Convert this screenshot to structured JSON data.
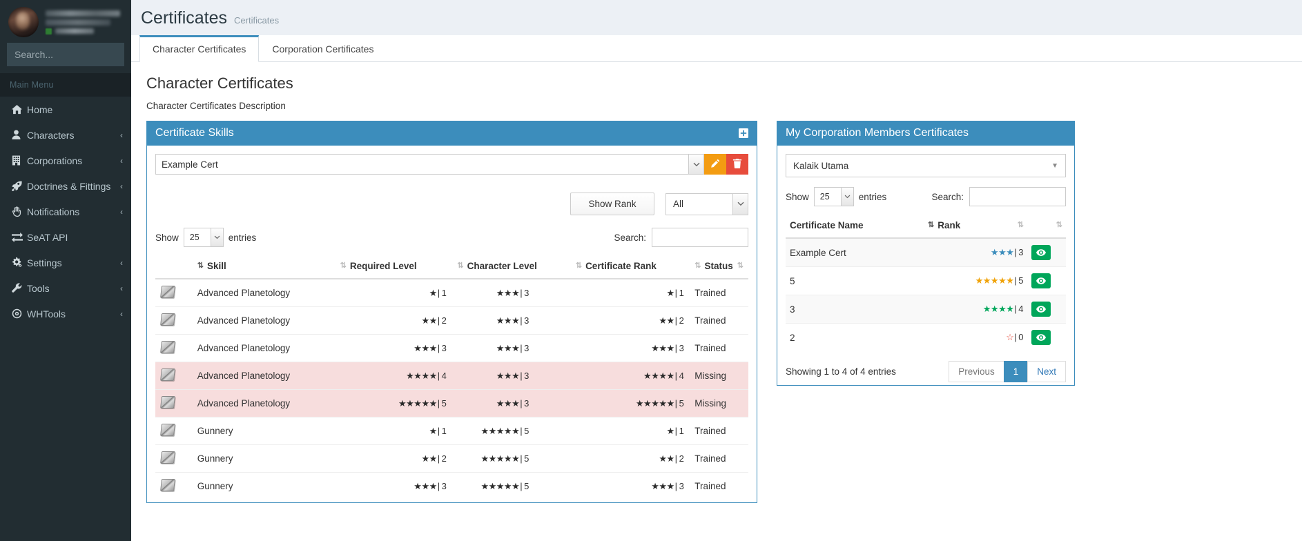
{
  "sidebar": {
    "user": {
      "name_redacted": true,
      "status_redacted": true
    },
    "search": {
      "placeholder": "Search...",
      "value": "",
      "icon": "search-icon"
    },
    "menu_header": "Main Menu",
    "items": [
      {
        "label": "Home",
        "icon": "home-icon",
        "arrow": ""
      },
      {
        "label": "Characters",
        "icon": "user-icon",
        "arrow": "‹"
      },
      {
        "label": "Corporations",
        "icon": "building-icon",
        "arrow": "‹"
      },
      {
        "label": "Doctrines & Fittings",
        "icon": "rocket-icon",
        "arrow": "‹"
      },
      {
        "label": "Notifications",
        "icon": "hand-icon",
        "arrow": "‹"
      },
      {
        "label": "SeAT API",
        "icon": "exchange-icon",
        "arrow": ""
      },
      {
        "label": "Settings",
        "icon": "gears-icon",
        "arrow": "‹"
      },
      {
        "label": "Tools",
        "icon": "wrench-icon",
        "arrow": "‹"
      },
      {
        "label": "WHTools",
        "icon": "circle-icon",
        "arrow": "‹"
      }
    ]
  },
  "header": {
    "title": "Certificates",
    "breadcrumb": "Certificates"
  },
  "tabs": [
    {
      "label": "Character Certificates",
      "active": true
    },
    {
      "label": "Corporation Certificates",
      "active": false
    }
  ],
  "main": {
    "section_title": "Character Certificates",
    "section_desc": "Character Certificates Description"
  },
  "cert_panel": {
    "title": "Certificate Skills",
    "expand_icon": "plus-square-icon",
    "selected_cert": "Example Cert",
    "edit_icon": "pencil-icon",
    "delete_icon": "trash-icon",
    "show_rank_label": "Show Rank",
    "rank_filter_value": "All",
    "show_label": "Show",
    "entries_label": "entries",
    "page_length": "25",
    "search_label": "Search:",
    "search_value": "",
    "columns": [
      "",
      "Skill",
      "Required Level",
      "Character Level",
      "Certificate Rank",
      "Status"
    ],
    "rows": [
      {
        "icon": "skillbook-icon",
        "skill": "Advanced Planetology",
        "required_level": 1,
        "character_level": 3,
        "certificate_rank": 1,
        "status": "Trained",
        "missing": false
      },
      {
        "icon": "skillbook-icon",
        "skill": "Advanced Planetology",
        "required_level": 2,
        "character_level": 3,
        "certificate_rank": 2,
        "status": "Trained",
        "missing": false
      },
      {
        "icon": "skillbook-icon",
        "skill": "Advanced Planetology",
        "required_level": 3,
        "character_level": 3,
        "certificate_rank": 3,
        "status": "Trained",
        "missing": false
      },
      {
        "icon": "skillbook-icon",
        "skill": "Advanced Planetology",
        "required_level": 4,
        "character_level": 3,
        "certificate_rank": 4,
        "status": "Missing",
        "missing": true
      },
      {
        "icon": "skillbook-icon",
        "skill": "Advanced Planetology",
        "required_level": 5,
        "character_level": 3,
        "certificate_rank": 5,
        "status": "Missing",
        "missing": true
      },
      {
        "icon": "skillbook-icon",
        "skill": "Gunnery",
        "required_level": 1,
        "character_level": 5,
        "certificate_rank": 1,
        "status": "Trained",
        "missing": false
      },
      {
        "icon": "skillbook-icon",
        "skill": "Gunnery",
        "required_level": 2,
        "character_level": 5,
        "certificate_rank": 2,
        "status": "Trained",
        "missing": false
      },
      {
        "icon": "skillbook-icon",
        "skill": "Gunnery",
        "required_level": 3,
        "character_level": 5,
        "certificate_rank": 3,
        "status": "Trained",
        "missing": false
      }
    ]
  },
  "members_panel": {
    "title": "My Corporation Members Certificates",
    "selected_member": "Kalaik Utama",
    "show_label": "Show",
    "entries_label": "entries",
    "page_length": "25",
    "search_label": "Search:",
    "search_value": "",
    "columns": [
      "Certificate Name",
      "Rank",
      ""
    ],
    "rows": [
      {
        "name": "Example Cert",
        "rank": 3,
        "rank_color": "blue",
        "action_icon": "eye-icon"
      },
      {
        "name": "5",
        "rank": 5,
        "rank_color": "orange",
        "action_icon": "eye-icon"
      },
      {
        "name": "3",
        "rank": 4,
        "rank_color": "green",
        "action_icon": "eye-icon"
      },
      {
        "name": "2",
        "rank": 0,
        "rank_color": "empty",
        "action_icon": "eye-icon"
      }
    ],
    "info": "Showing 1 to 4 of 4 entries",
    "pagination": {
      "previous": "Previous",
      "pages": [
        "1"
      ],
      "next": "Next",
      "current": "1"
    }
  },
  "colors": {
    "sidebar_bg": "#222d32",
    "panel_header": "#3c8dbc",
    "edit_button": "#f39c12",
    "delete_button": "#e74c3c",
    "eye_button": "#00a65a",
    "missing_row": "#f7dddd"
  }
}
